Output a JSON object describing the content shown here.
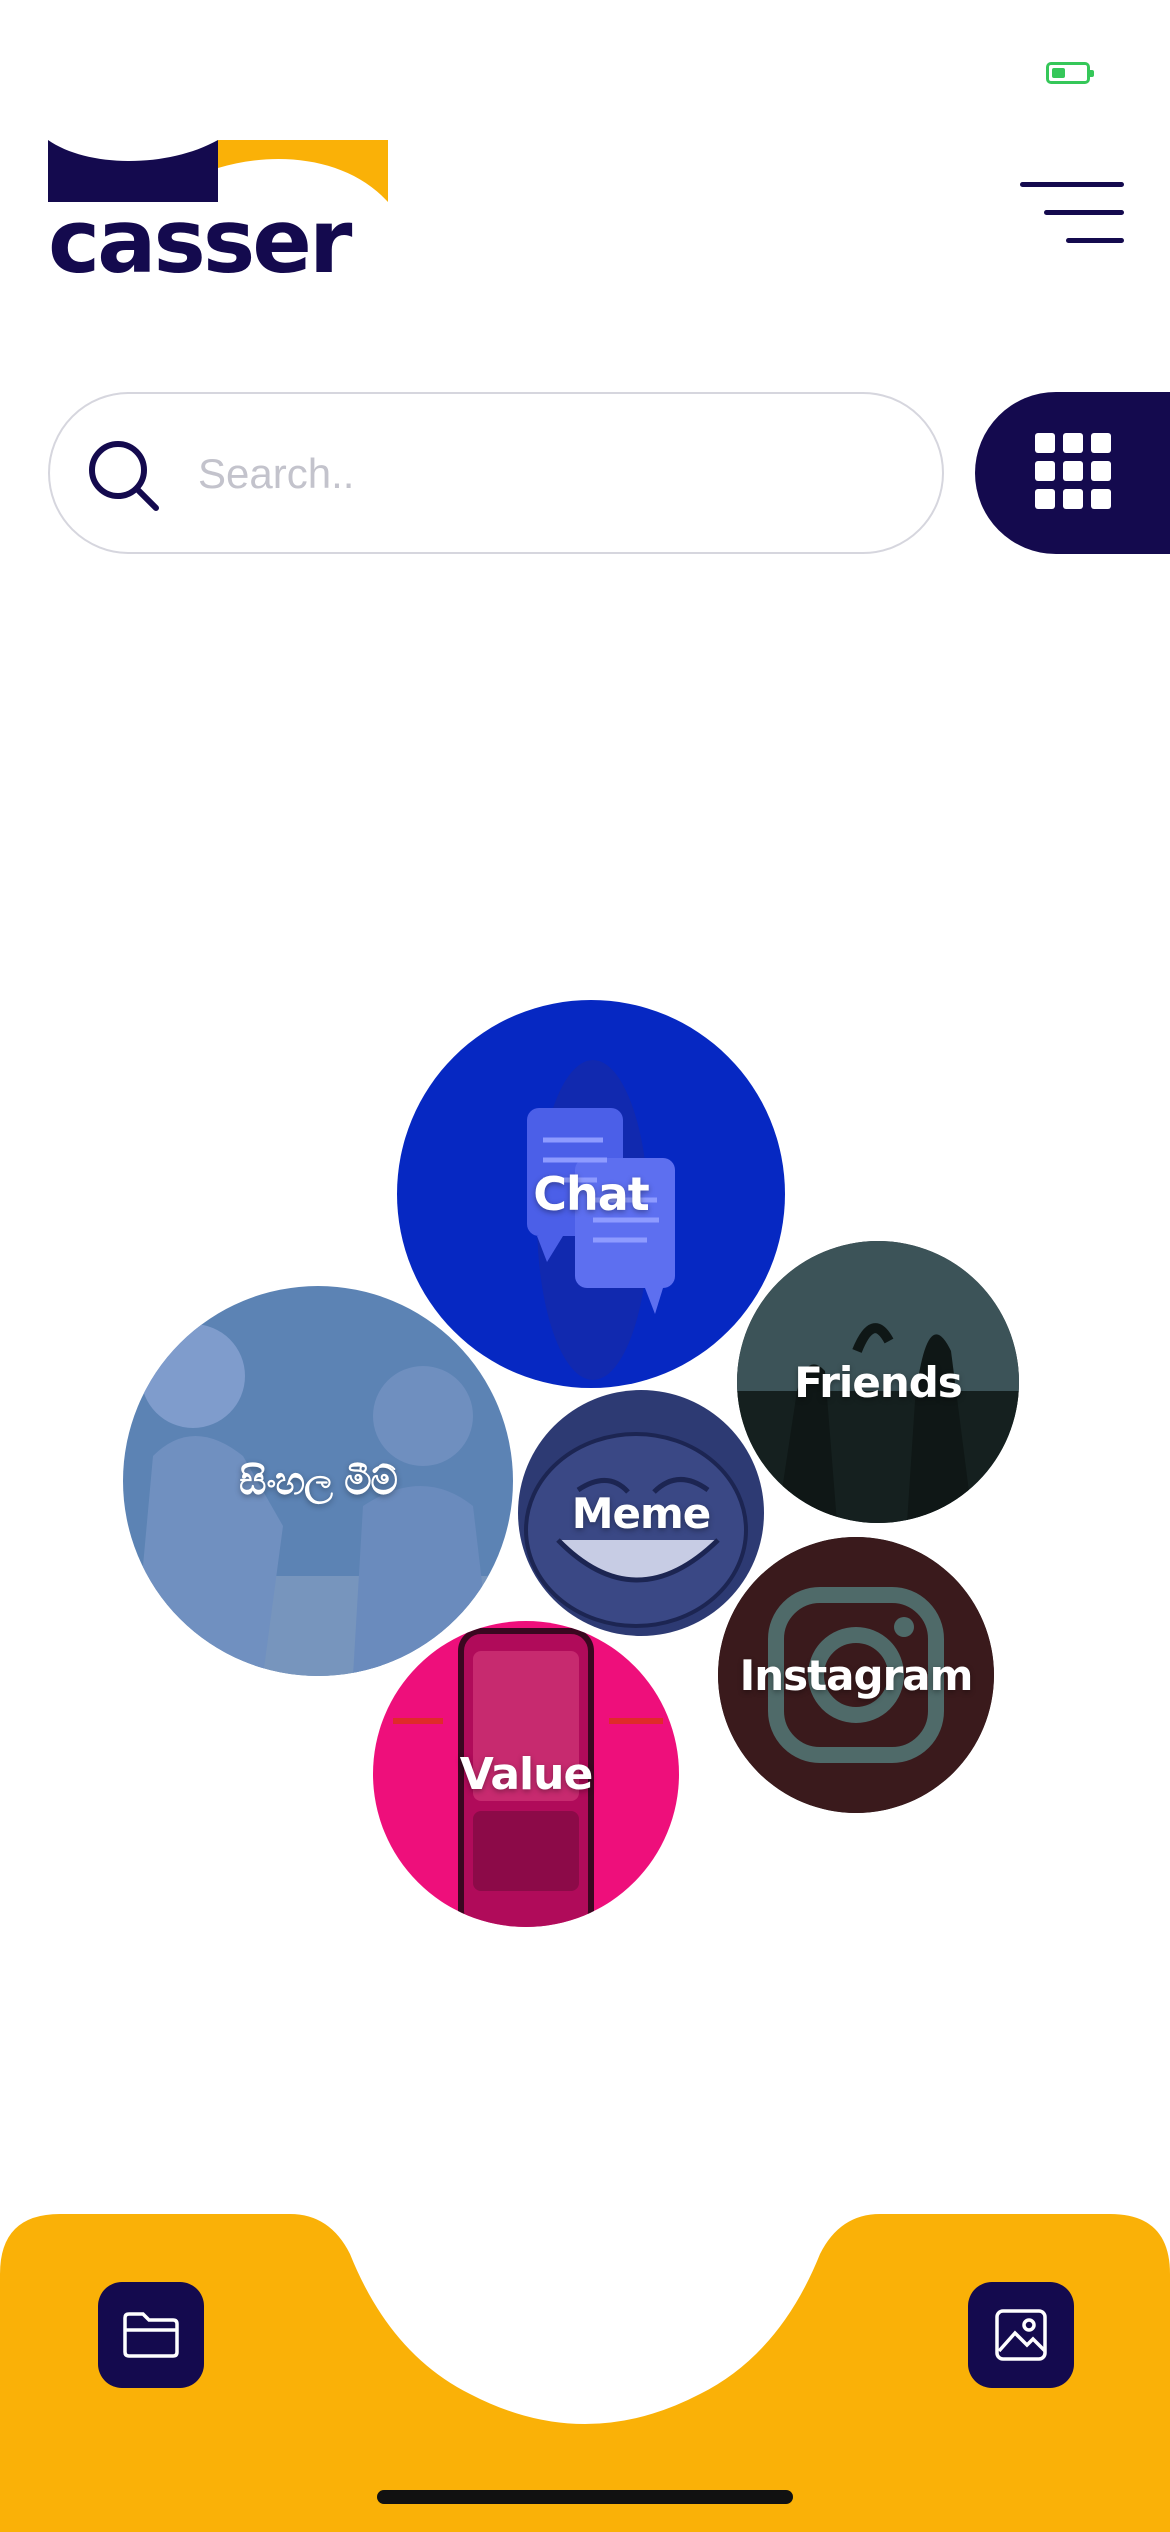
{
  "app": {
    "logo_text": "casser"
  },
  "colors": {
    "primary": "#140a4e",
    "accent": "#fab107",
    "status_green": "#35c759"
  },
  "search": {
    "placeholder": "Search.."
  },
  "bubbles": [
    {
      "label": "Chat",
      "color": "#0628c2",
      "icon": "chat-icon"
    },
    {
      "label": "Friends",
      "color": "#1d2b2f",
      "icon": "friends-photo"
    },
    {
      "label": "සිංහල මීම්",
      "color": "#5c83b4",
      "icon": "people-photo"
    },
    {
      "label": "Meme",
      "color": "#2d3a73",
      "icon": "troll-face"
    },
    {
      "label": "Instagram",
      "color": "#2a1416",
      "icon": "instagram-icon"
    },
    {
      "label": "Value",
      "color": "#ee0f7b",
      "icon": "phone-photo"
    }
  ],
  "bottom_nav": {
    "left_icon": "folder-icon",
    "right_icon": "image-icon"
  }
}
